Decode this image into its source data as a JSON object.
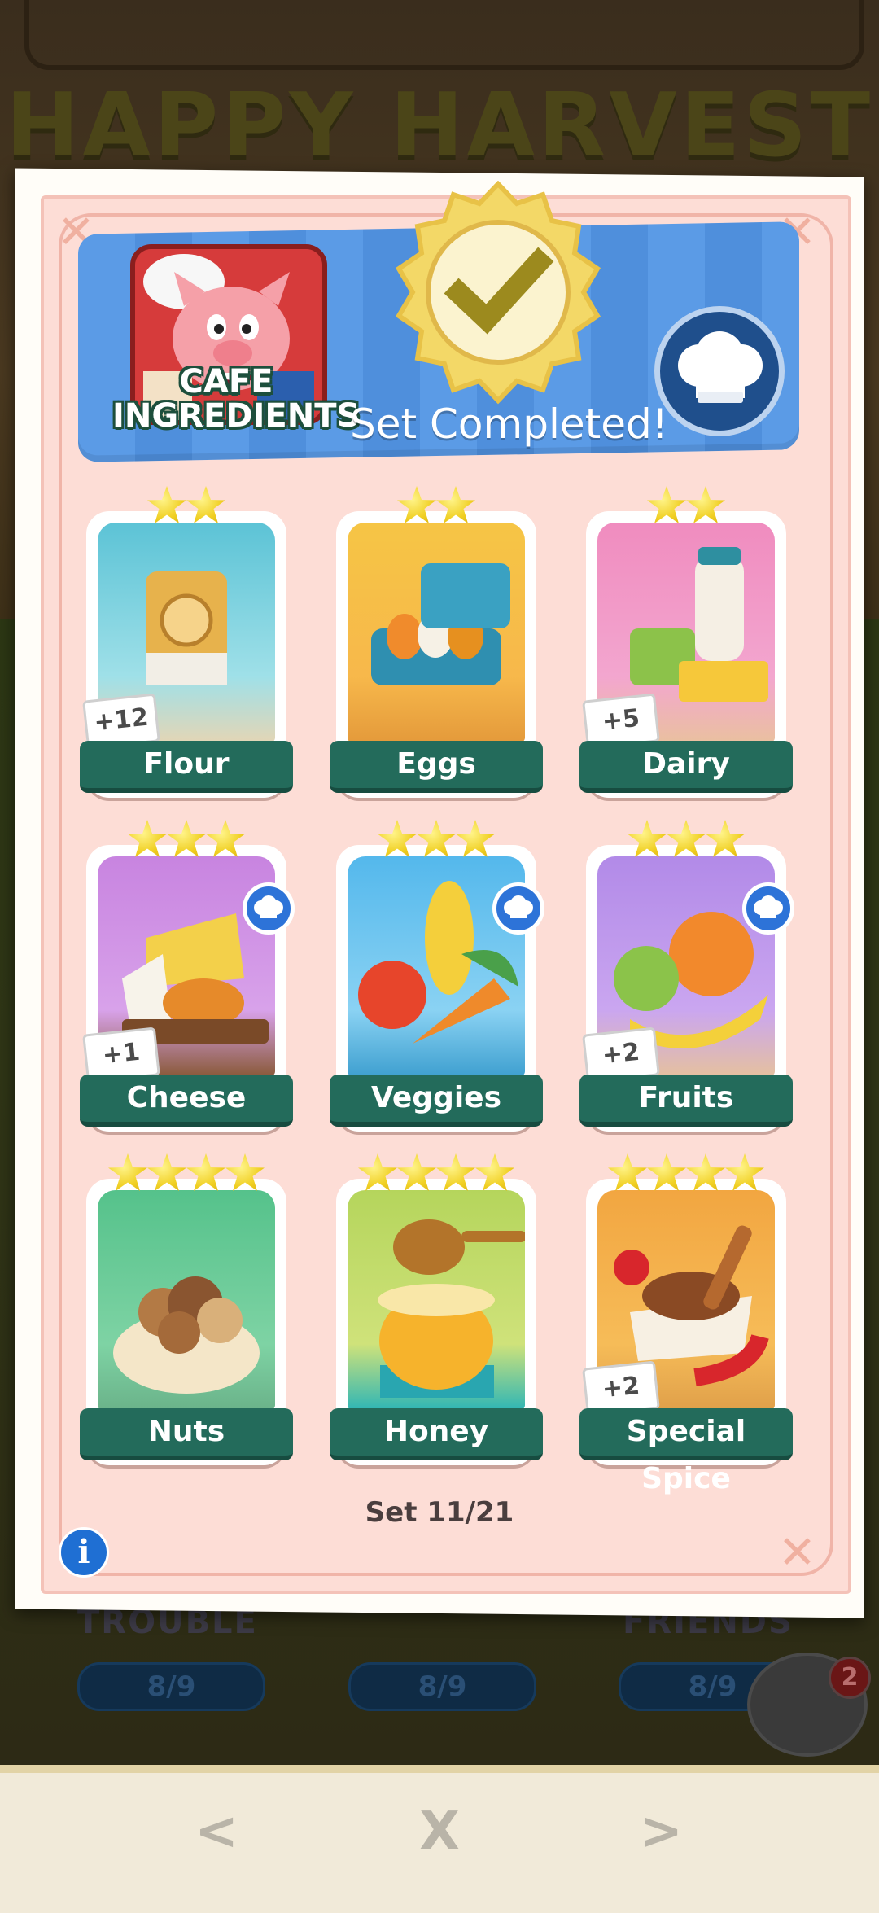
{
  "background": {
    "title": "HAPPY HARVEST",
    "under_sheet_labels": [
      "TROUBLE",
      "FRIENDS"
    ],
    "progress_pills": [
      "8/9",
      "8/9",
      "8/9"
    ],
    "album_badge_count": "2"
  },
  "set": {
    "name_line1": "CAFE",
    "name_line2": "INGREDIENTS",
    "status": "Set Completed!",
    "counter": "Set 11/21"
  },
  "cards": [
    {
      "name": "Flour",
      "stars": 2,
      "duplicates": "+12",
      "chef": false
    },
    {
      "name": "Eggs",
      "stars": 2,
      "duplicates": "",
      "chef": false
    },
    {
      "name": "Dairy",
      "stars": 2,
      "duplicates": "+5",
      "chef": false
    },
    {
      "name": "Cheese",
      "stars": 3,
      "duplicates": "+1",
      "chef": true
    },
    {
      "name": "Veggies",
      "stars": 3,
      "duplicates": "",
      "chef": true
    },
    {
      "name": "Fruits",
      "stars": 3,
      "duplicates": "+2",
      "chef": true
    },
    {
      "name": "Nuts",
      "stars": 4,
      "duplicates": "",
      "chef": false
    },
    {
      "name": "Honey",
      "stars": 4,
      "duplicates": "",
      "chef": false
    },
    {
      "name": "Special Spice",
      "stars": 4,
      "duplicates": "+2",
      "chef": false
    }
  ],
  "nav": {
    "prev": "<",
    "close": "X",
    "next": ">"
  },
  "info_label": "i",
  "colors": {
    "sheet": "#fdddd6",
    "banner": "#5b9be6",
    "label_bar": "#236b5b",
    "star": "#f0cf22"
  }
}
